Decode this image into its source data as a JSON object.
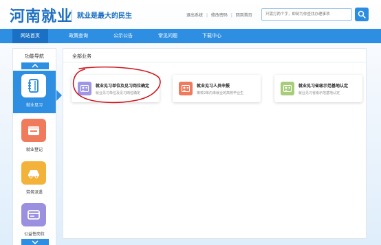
{
  "header": {
    "logo": "河南就业",
    "slogan": "就业是最大的民生",
    "links": [
      "退出系统",
      "修改密码",
      "回到首页"
    ],
    "search_placeholder": "只需打两个字，即刻为你查找办理事项"
  },
  "nav": {
    "items": [
      "网站首页",
      "政策查询",
      "公示公告",
      "常见问题",
      "下载中心"
    ],
    "active_index": 0
  },
  "sidebar": {
    "title": "功能导航",
    "items": [
      {
        "label": "就业见习",
        "icon": "notebook-icon",
        "color": "#2e8fe2",
        "active": true
      },
      {
        "label": "就业登记",
        "icon": "calendar-icon",
        "color": "#f07a5c",
        "active": false
      },
      {
        "label": "劳务派遣",
        "icon": "car-icon",
        "color": "#f3b23a",
        "active": false
      },
      {
        "label": "公益性岗位",
        "icon": "card-icon",
        "color": "#9b8fe0",
        "active": false
      }
    ]
  },
  "main": {
    "title": "全部业务",
    "cards": [
      {
        "title": "就业见习单位及见习岗位确定",
        "desc": "就业见习单位及见习岗位确定",
        "icon": "id-card-icon",
        "color": "#9f97e6"
      },
      {
        "title": "就业见习人员申报",
        "desc": "离校2年内未就业的高校毕业生",
        "icon": "id-card-icon",
        "color": "#f07a5c"
      },
      {
        "title": "就业见习省级示范基地认定",
        "desc": "就业见习省级示范基地认定",
        "icon": "id-card-icon",
        "color": "#a7cc7a"
      }
    ]
  },
  "colors": {
    "primary": "#2e8fe2",
    "nav_active": "#1a70c4",
    "annotation": "#d0141b"
  }
}
